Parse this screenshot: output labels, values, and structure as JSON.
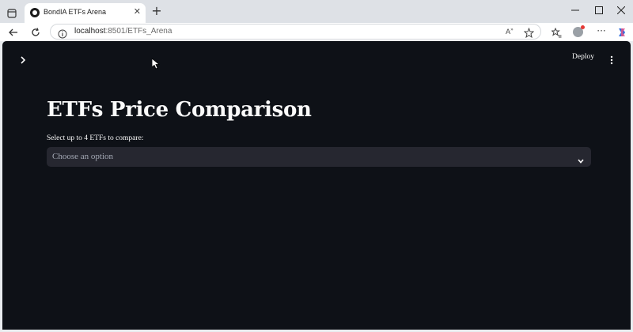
{
  "browser": {
    "tab_title": "BondIA ETFs Arena",
    "tab_close_icon": "close-icon",
    "new_tab_glyph": "+",
    "url_host": "localhost",
    "url_path": ":8501/ETFs_Arena",
    "window_controls": [
      "minimize-icon",
      "maximize-icon",
      "close-icon"
    ]
  },
  "app": {
    "header": {
      "deploy_label": "Deploy"
    },
    "title": "ETFs Price Comparison",
    "multiselect": {
      "label": "Select up to 4 ETFs to compare:",
      "placeholder": "Choose an option"
    }
  },
  "colors": {
    "app_background": "#0e1117",
    "input_background": "#262730",
    "text": "#fafafa",
    "placeholder": "#a3a8b4"
  }
}
